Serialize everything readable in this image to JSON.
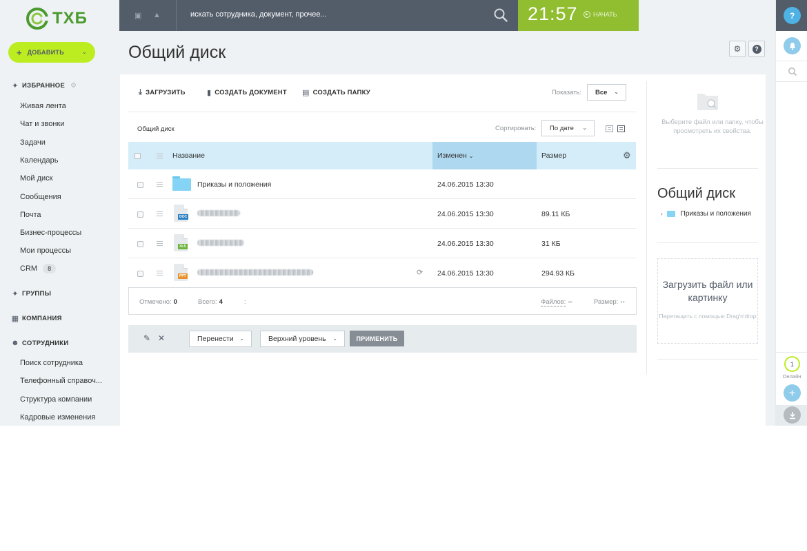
{
  "brand": {
    "name": "ТХБ",
    "color": "#4a9a2e"
  },
  "sidebar": {
    "add_button": "ДОБАВИТЬ",
    "favorites_title": "ИЗБРАННОЕ",
    "favorites": [
      "Живая лента",
      "Чат и звонки",
      "Задачи",
      "Календарь",
      "Мой диск",
      "Сообщения",
      "Почта",
      "Бизнес-процессы",
      "Мои процессы",
      "CRM"
    ],
    "crm_count": "8",
    "groups_title": "ГРУППЫ",
    "company_title": "КОМПАНИЯ",
    "employees_title": "СОТРУДНИКИ",
    "employees": [
      "Поиск сотрудника",
      "Телефонный справоч...",
      "Структура компании",
      "Кадровые изменения"
    ]
  },
  "topbar": {
    "search_placeholder": "искать сотрудника, документ, прочее...",
    "clock": "21:57",
    "start_label": "НАЧАТЬ",
    "clock_bar_color": "#90be30"
  },
  "page": {
    "title": "Общий диск"
  },
  "toolbar": {
    "upload": "ЗАГРУЗИТЬ",
    "create_doc": "СОЗДАТЬ ДОКУМЕНТ",
    "create_folder": "СОЗДАТЬ ПАПКУ",
    "show_label": "Показать:",
    "show_value": "Все"
  },
  "listing": {
    "breadcrumb": "Общий диск",
    "sort_label": "Сортировать:",
    "sort_value": "По дате",
    "columns": {
      "name": "Название",
      "modified": "Изменен",
      "size": "Размер"
    },
    "rows": [
      {
        "type": "folder",
        "name": "Приказы и положения",
        "modified": "24.06.2015 13:30",
        "size": ""
      },
      {
        "type": "DOC",
        "name": "",
        "modified": "24.06.2015 13:30",
        "size": "89.11 КБ"
      },
      {
        "type": "XLS",
        "name": "",
        "modified": "24.06.2015 13:30",
        "size": "31 КБ"
      },
      {
        "type": "PPT",
        "name": "",
        "modified": "24.06.2015 13:30",
        "size": "294.93 КБ"
      }
    ],
    "footer": {
      "selected_label": "Отмечено:",
      "selected_value": "0",
      "total_label": "Всего:",
      "total_value": "4",
      "colon": ":",
      "files_label": "Файлов:",
      "files_value": "--",
      "size_label": "Размер:",
      "size_value": "--"
    }
  },
  "action_bar": {
    "move_select": "Перенести",
    "level_select": "Верхний уровень",
    "apply": "ПРИМЕНИТЬ"
  },
  "info_panel": {
    "hint": "Выберите файл или папку, чтобы просмотреть их свойства.",
    "title": "Общий диск",
    "tree_item": "Приказы и положения",
    "drop_title": "Загрузить файл или картинку",
    "drop_sub": "Перетащить с помощью Drag'n'drop"
  },
  "right_strip": {
    "help": "?",
    "online_count": "1",
    "online_label": "Онлайн"
  }
}
